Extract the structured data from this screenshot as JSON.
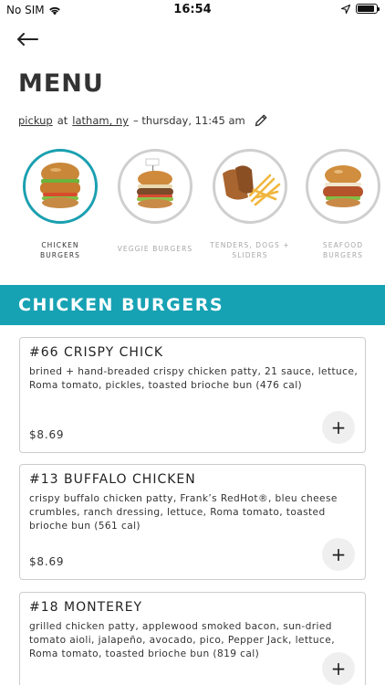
{
  "status_bar": {
    "carrier": "No SIM",
    "time": "16:54"
  },
  "header": {
    "title": "MENU"
  },
  "order": {
    "mode": "pickup",
    "at": "at",
    "location": "latham, ny",
    "when": "– thursday, 11:45 am"
  },
  "categories": [
    {
      "label_line1": "CHICKEN",
      "label_line2": "BURGERS",
      "active": true
    },
    {
      "label_line1": "VEGGIE BURGERS",
      "label_line2": "",
      "active": false
    },
    {
      "label_line1": "TENDERS, DOGS +",
      "label_line2": "SLIDERS",
      "active": false
    },
    {
      "label_line1": "SEAFOOD",
      "label_line2": "BURGERS",
      "active": false
    }
  ],
  "section": {
    "title": "CHICKEN BURGERS"
  },
  "items": [
    {
      "name": "#66 CRISPY CHICK",
      "description": "brined + hand-breaded crispy chicken patty, 21 sauce, lettuce, Roma tomato, pickles, toasted brioche bun (476 cal)",
      "price": "$8.69"
    },
    {
      "name": "#13 BUFFALO CHICKEN",
      "description": "crispy buffalo chicken patty, Frank’s RedHot®, bleu cheese crumbles, ranch dressing, lettuce, Roma tomato, toasted brioche bun (561 cal)",
      "price": "$8.69"
    },
    {
      "name": "#18 MONTEREY",
      "description": "grilled chicken patty, applewood smoked bacon, sun-dried tomato aioli, jalapeño, avocado, pico, Pepper Jack, lettuce, Roma tomato, toasted brioche bun (819 cal)",
      "price": ""
    }
  ],
  "add_button_label": "+",
  "icons": {
    "back": "arrow-left-icon",
    "edit": "pencil-icon",
    "wifi": "wifi-icon",
    "location": "location-arrow-icon",
    "battery": "battery-icon"
  },
  "colors": {
    "accent": "#17a2b4",
    "text": "#333333",
    "inactive": "#a7a7a7"
  }
}
